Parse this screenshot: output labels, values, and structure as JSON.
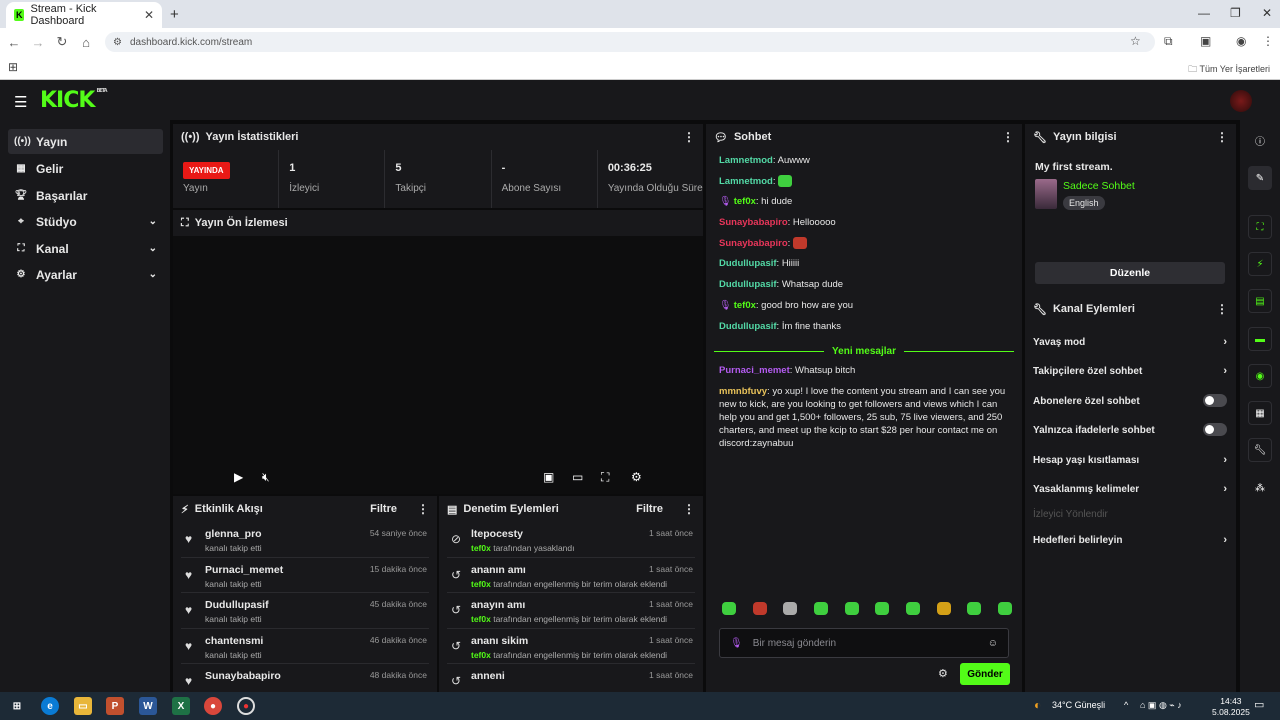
{
  "browser": {
    "tab_title": "Stream - Kick Dashboard",
    "url": "dashboard.kick.com/stream",
    "bookmarks_label": "Tüm Yer İşaretleri"
  },
  "brand": {
    "logo": "KICK",
    "badge": "BETA",
    "accent": "#53fc18"
  },
  "sidebar": {
    "items": [
      {
        "label": "Yayın",
        "icon": "broadcast-icon",
        "active": true,
        "expandable": false
      },
      {
        "label": "Gelir",
        "icon": "revenue-icon",
        "active": false,
        "expandable": false
      },
      {
        "label": "Başarılar",
        "icon": "trophy-icon",
        "active": false,
        "expandable": false
      },
      {
        "label": "Stüdyo",
        "icon": "studio-icon",
        "active": false,
        "expandable": true
      },
      {
        "label": "Kanal",
        "icon": "channel-icon",
        "active": false,
        "expandable": true
      },
      {
        "label": "Ayarlar",
        "icon": "gear-icon",
        "active": false,
        "expandable": true
      }
    ]
  },
  "stats": {
    "title": "Yayın İstatistikleri",
    "live_badge": "YAYINDA",
    "items": [
      {
        "value": "",
        "label": "Yayın"
      },
      {
        "value": "1",
        "label": "İzleyici"
      },
      {
        "value": "5",
        "label": "Takipçi"
      },
      {
        "value": "-",
        "label": "Abone Sayısı"
      },
      {
        "value": "00:36:25",
        "label": "Yayında Olduğu Süre"
      }
    ]
  },
  "preview": {
    "title": "Yayın Ön İzlemesi"
  },
  "activity": {
    "title": "Etkinlik Akışı",
    "filter": "Filtre",
    "items": [
      {
        "name": "glenna_pro",
        "action": "kanalı takip etti",
        "time": "54 saniye önce"
      },
      {
        "name": "Purnaci_memet",
        "action": "kanalı takip etti",
        "time": "15 dakika önce"
      },
      {
        "name": "Dudullupasif",
        "action": "kanalı takip etti",
        "time": "45 dakika önce"
      },
      {
        "name": "chantensmi",
        "action": "kanalı takip etti",
        "time": "46 dakika önce"
      },
      {
        "name": "Sunaybabapiro",
        "action": "",
        "time": "48 dakika önce"
      }
    ]
  },
  "moderation": {
    "title": "Denetim Eylemleri",
    "filter": "Filtre",
    "items": [
      {
        "name": "ltepocesty",
        "by": "tef0x",
        "action": "tarafından yasaklandı",
        "time": "1 saat önce"
      },
      {
        "name": "ananın amı",
        "by": "tef0x",
        "action": "tarafından engellenmiş bir terim olarak eklendi",
        "time": "1 saat önce"
      },
      {
        "name": "anayın amı",
        "by": "tef0x",
        "action": "tarafından engellenmiş bir terim olarak eklendi",
        "time": "1 saat önce"
      },
      {
        "name": "ananı sikim",
        "by": "tef0x",
        "action": "tarafından engellenmiş bir terim olarak eklendi",
        "time": "1 saat önce"
      },
      {
        "name": "anneni",
        "by": "",
        "action": "",
        "time": "1 saat önce"
      }
    ]
  },
  "chat": {
    "title": "Sohbet",
    "messages": [
      {
        "user": "Lamnetmod",
        "color": "#53d9a6",
        "text": "Auwww"
      },
      {
        "user": "Lamnetmod",
        "color": "#53d9a6",
        "text": "",
        "emote": "#3fcf3f"
      },
      {
        "user": "tef0x",
        "color": "#53fc18",
        "text": "hi dude",
        "mic": true
      },
      {
        "user": "Sunaybabapiro",
        "color": "#e8365a",
        "text": "Hellooooo"
      },
      {
        "user": "Sunaybabapiro",
        "color": "#e8365a",
        "text": "",
        "emote": "#c0392b"
      },
      {
        "user": "Dudullupasif",
        "color": "#53d9a6",
        "text": "Hiiiii"
      },
      {
        "user": "Dudullupasif",
        "color": "#53d9a6",
        "text": "Whatsap dude"
      },
      {
        "user": "tef0x",
        "color": "#53fc18",
        "text": "good bro how are you",
        "mic": true
      },
      {
        "user": "Dudullupasif",
        "color": "#53d9a6",
        "text": "İm fine thanks"
      }
    ],
    "new_divider": "Yeni mesajlar",
    "new_messages": [
      {
        "user": "Purnaci_memet",
        "color": "#b45cf0",
        "text": "Whatsup bitch"
      },
      {
        "user": "mmnbfuvy",
        "color": "#e8c25a",
        "text": "yo xup! I love the content you stream and I can see you new to kick, are you looking to get followers and views which I can help you and get 1,500+ followers, 25 sub, 75 live viewers, and 250 charters, and meet up the kcip to start $28 per hour contact me on discord:zaynabuu"
      }
    ],
    "input_placeholder": "Bir mesaj gönderin",
    "send_label": "Gönder"
  },
  "stream_info": {
    "title": "Yayın bilgisi",
    "stream_title": "My first stream.",
    "category": "Sadece Sohbet",
    "language": "English",
    "edit_label": "Düzenle"
  },
  "channel_actions": {
    "title": "Kanal Eylemleri",
    "items": [
      {
        "label": "Yavaş mod",
        "kind": "chevron"
      },
      {
        "label": "Takipçilere özel sohbet",
        "kind": "chevron"
      },
      {
        "label": "Abonelere özel sohbet",
        "kind": "toggle"
      },
      {
        "label": "Yalnızca ifadelerle sohbet",
        "kind": "toggle"
      },
      {
        "label": "Hesap yaşı kısıtlaması",
        "kind": "chevron"
      },
      {
        "label": "Yasaklanmış kelimeler",
        "kind": "chevron"
      },
      {
        "label": "İzleyici Yönlendir",
        "kind": "disabled"
      },
      {
        "label": "Hedefleri belirleyin",
        "kind": "chevron"
      }
    ]
  },
  "taskbar": {
    "weather": "34°C Güneşli",
    "time": "14:43",
    "date": "5.08.2025"
  }
}
